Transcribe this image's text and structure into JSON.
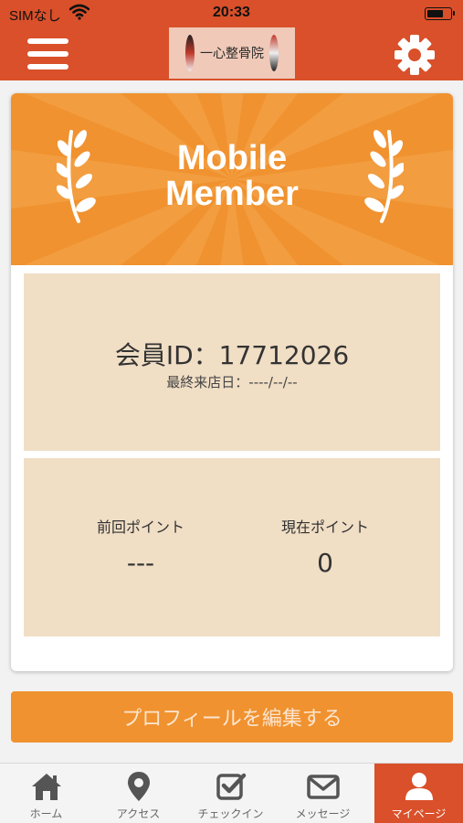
{
  "status_bar": {
    "carrier": "SIMなし",
    "time": "20:33",
    "battery_level": 0.75
  },
  "header": {
    "logo_text": "一心整骨院",
    "menu_icon": "hamburger-menu-icon",
    "settings_icon": "gear-icon"
  },
  "member_card": {
    "title_line1": "Mobile",
    "title_line2": "Member",
    "member_id_text": "会員ID：17712026",
    "last_visit_text": "最終来店日：----/--/--",
    "previous_points_label": "前回ポイント",
    "previous_points_value": "---",
    "current_points_label": "現在ポイント",
    "current_points_value": "0"
  },
  "edit_profile_label": "プロフィールを編集する",
  "tabs": [
    {
      "label": "ホーム",
      "icon": "home-icon"
    },
    {
      "label": "アクセス",
      "icon": "map-pin-icon"
    },
    {
      "label": "チェックイン",
      "icon": "checkbox-icon"
    },
    {
      "label": "メッセージ",
      "icon": "envelope-icon"
    },
    {
      "label": "マイページ",
      "icon": "user-icon"
    }
  ],
  "colors": {
    "brand": "#d9502a",
    "accent": "#f0922f",
    "panel": "#f0dec5"
  }
}
